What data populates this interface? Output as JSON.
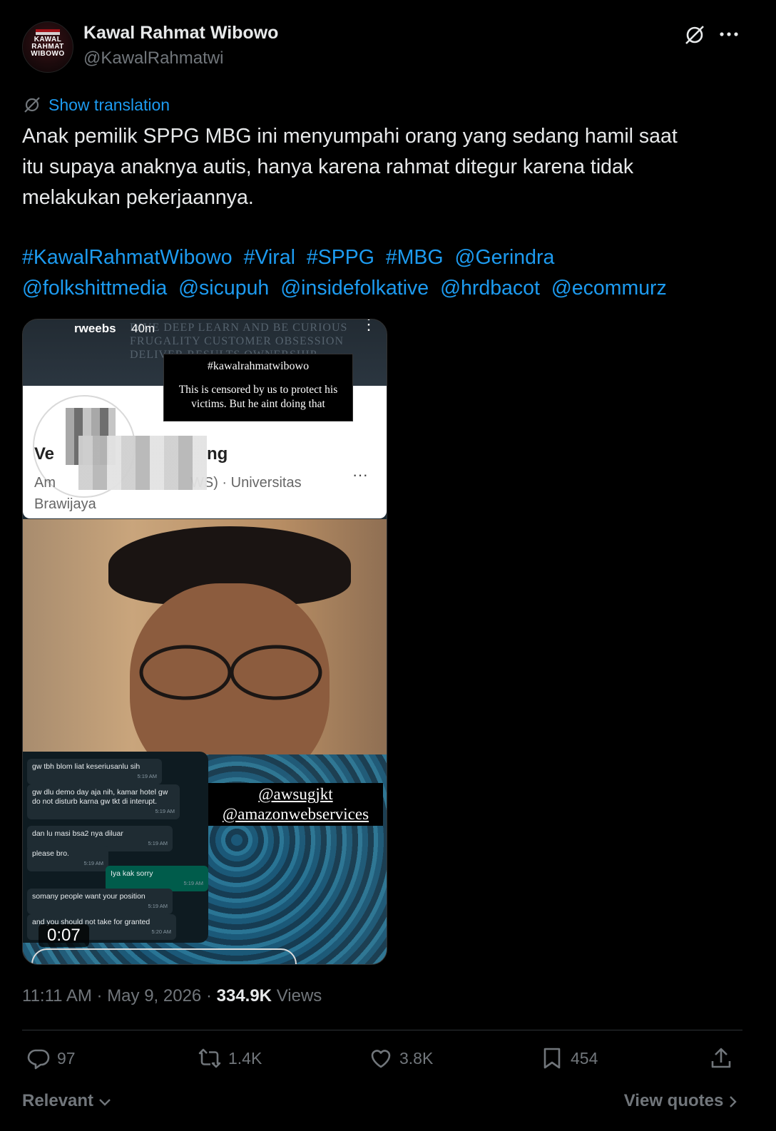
{
  "author": {
    "display_name": "Kawal Rahmat Wibowo",
    "handle": "@KawalRahmatwi",
    "avatar_text": "KAWAL RAHMAT WIBOWO"
  },
  "icons": {
    "grok": "grok-icon",
    "more": "more-icon",
    "translate": "translate-icon",
    "reply": "reply-icon",
    "repost": "repost-icon",
    "like": "like-icon",
    "bookmark": "bookmark-icon",
    "share": "share-icon"
  },
  "translation_link": "Show translation",
  "body": {
    "line1": "Anak pemilik SPPG MBG ini menyumpahi orang yang sedang hamil saat",
    "line2": "itu supaya anaknya autis, hanya karena rahmat ditegur karena tidak",
    "line3": "melakukan pekerjaannya."
  },
  "tags": [
    "#KawalRahmatWibowo",
    "#Viral",
    "#SPPG",
    "#MBG",
    "@Gerindra",
    "@folkshittmedia",
    "@sicupuh",
    "@insidefolkative",
    "@hrdbacot",
    "@ecommurz"
  ],
  "media": {
    "story_username": "rweebs",
    "story_time": "40m",
    "bg_words": "DIVE DEEP LEARN AND BE CURIOUS FRUGALITY CUSTOMER OBSESSION DELIVER RESULTS OWNERSHIP",
    "notice_tag": "#kawalrahmatwibowo",
    "notice_text": "This is censored by us to protect his victims. But he aint doing that",
    "card_name_start": "Ve",
    "card_name_end": "ng",
    "card_sub_start": "Am",
    "card_sub_mid": "WS)   ·   Universitas",
    "card_sub_end": "Brawijaya",
    "handles": [
      "@awsugjkt",
      "@amazonwebservices"
    ],
    "chat": [
      {
        "text": "gw tbh blom liat keseriusanlu sih",
        "time": "5:19 AM",
        "dir": "in"
      },
      {
        "text": "gw dlu demo day aja nih, kamar hotel gw do not disturb karna gw tkt di interupt.",
        "time": "5:19 AM",
        "dir": "in"
      },
      {
        "text": "dan lu masi bsa2 nya diluar",
        "time": "5:19 AM",
        "dir": "in"
      },
      {
        "text": "please bro.",
        "time": "5:19 AM",
        "dir": "in"
      },
      {
        "text": "Iya kak sorry",
        "time": "5:19 AM",
        "dir": "out"
      },
      {
        "text": "somany people want your position",
        "time": "5:19 AM",
        "dir": "in"
      },
      {
        "text": "and you should not take for granted",
        "time": "5:20 AM",
        "dir": "in"
      }
    ],
    "duration": "0:07"
  },
  "meta": {
    "time": "11:11 AM",
    "date": "May 9, 2026",
    "views_count": "334.9K",
    "views_label": "Views"
  },
  "actions": {
    "replies": "97",
    "reposts": "1.4K",
    "likes": "3.8K",
    "bookmarks": "454"
  },
  "footer": {
    "sort": "Relevant",
    "quotes": "View quotes"
  }
}
